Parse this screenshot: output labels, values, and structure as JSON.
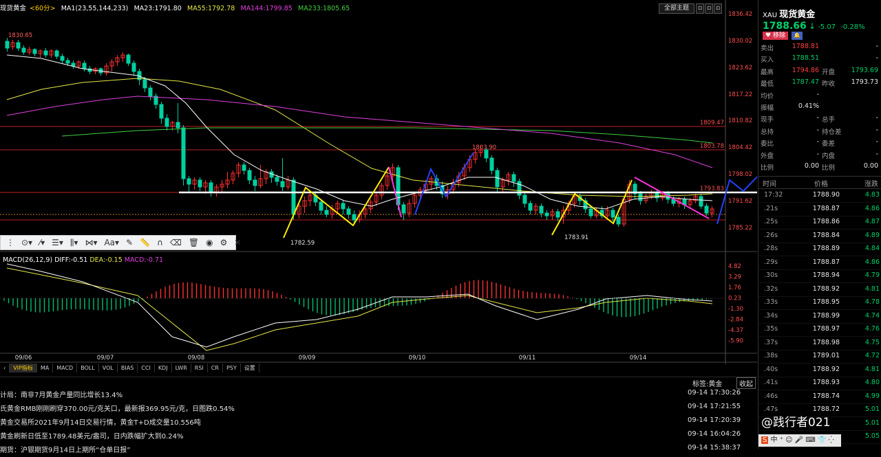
{
  "header": {
    "symbol_name": "现货黄金",
    "period": "<60分>",
    "ma_label": "MA1(23,55,144,233)",
    "ma23": "MA23:1791.80",
    "ma55": "MA55:1792.78",
    "ma144": "MA144:1799.85",
    "ma233": "MA233:1805.65",
    "theme_button": "全部主题",
    "colors": {
      "ma23": "#ffffff",
      "ma55": "#e8e84a",
      "ma144": "#e040e0",
      "ma233": "#40d040",
      "up": "#ff3030",
      "down": "#00d0a0"
    }
  },
  "price_axis": [
    "1836.42",
    "1830.02",
    "1823.62",
    "1817.22",
    "1810.82",
    "1804.42",
    "1798.02",
    "1791.62",
    "1785.22"
  ],
  "price_labels": {
    "high": "1830.65",
    "peak": "1803.90",
    "low1": "1782.59",
    "low2": "1783.91",
    "level1": "1809.47",
    "level2": "1803.78",
    "level3": "1793.83"
  },
  "macd": {
    "label": "MACD(26,12,9)",
    "diff": "DIFF:-0.51",
    "dea": "DEA:-0.15",
    "macd": "MACD:-0.71",
    "axis": [
      "4.82",
      "3.29",
      "1.76",
      "0.23",
      "-1.30",
      "-2.84",
      "-4.37",
      "-5.90"
    ]
  },
  "dates": [
    "09/06",
    "09/07",
    "09/08",
    "09/09",
    "09/10",
    "09/11",
    "09/14"
  ],
  "indicator_tabs": [
    "VIP指标",
    "MA",
    "MACD",
    "BOLL",
    "VOL",
    "BIAS",
    "CCI",
    "KDJ",
    "LWR",
    "RSI",
    "CR",
    "PSY",
    "设置"
  ],
  "news": {
    "tag": "标签:黄金",
    "collapse": "收起",
    "items": [
      {
        "text": "计局：南非7月黄金产量同比增长13.4%",
        "date": "09-14 17:30:26"
      },
      {
        "text": "氏黄金RMB刚刚刷穿370.00元/克关口，最新报369.95元/克，日图跌0.54%",
        "date": "09-14 17:21:55"
      },
      {
        "text": "黄金交易所2021年9月14日交易行情，黄金T+D成交量10.556吨",
        "date": "09-14 17:20:39"
      },
      {
        "text": "黄金刷新日低至1789.48美元/盎司，日内跌幅扩大到0.24%",
        "date": "09-14 16:04:26"
      },
      {
        "text": "期货：沪银期货9月14日上期所“仓单日报”",
        "date": "09-14 15:38:37"
      }
    ]
  },
  "quote": {
    "code": "XAU",
    "name": "现货黄金",
    "price": "1788.66",
    "arrow": "↓",
    "change": "-5.07",
    "pct": "-0.28%",
    "btn_remove": "移除",
    "btn_alert": "🔔",
    "fields": [
      {
        "l": "卖出",
        "v": "1788.81",
        "l2": "",
        "v2": "-"
      },
      {
        "l": "买入",
        "v": "1788.51",
        "l2": "",
        "v2": "-"
      },
      {
        "l": "最高",
        "v": "1794.86",
        "l2": "开盘",
        "v2": "1793.69"
      },
      {
        "l": "最低",
        "v": "1787.47",
        "l2": "昨收",
        "v2": "1793.73"
      },
      {
        "l": "均价",
        "v": "-",
        "l2": "",
        "v2": ""
      },
      {
        "l": "振幅",
        "v": "0.41%",
        "l2": "",
        "v2": ""
      },
      {
        "l": "现手",
        "v": "-",
        "l2": "总手",
        "v2": "-"
      },
      {
        "l": "总持",
        "v": "-",
        "l2": "持仓差",
        "v2": "-"
      },
      {
        "l": "委比",
        "v": "-",
        "l2": "委差",
        "v2": "-"
      },
      {
        "l": "外盘",
        "v": "-",
        "l2": "内盘",
        "v2": "-"
      },
      {
        "l": "比例",
        "v": "0.00",
        "l2": "比例",
        "v2": "0.00"
      }
    ],
    "tick_headers": [
      "时间",
      "价格",
      "涨跌"
    ],
    "ticks": [
      {
        "t": "17:32",
        "p": "1788.90",
        "c": "4.83"
      },
      {
        "t": ".21s",
        "p": "1788.87",
        "c": "4.86"
      },
      {
        "t": ".25s",
        "p": "1788.86",
        "c": "4.87"
      },
      {
        "t": ".26s",
        "p": "1788.84",
        "c": "4.89"
      },
      {
        "t": ".28s",
        "p": "1788.89",
        "c": "4.84"
      },
      {
        "t": ".29s",
        "p": "1788.87",
        "c": "4.86"
      },
      {
        "t": ".30s",
        "p": "1788.94",
        "c": "4.79"
      },
      {
        "t": ".32s",
        "p": "1788.92",
        "c": "4.81"
      },
      {
        "t": ".33s",
        "p": "1788.95",
        "c": "4.78"
      },
      {
        "t": ".34s",
        "p": "1788.99",
        "c": "4.74"
      },
      {
        "t": ".35s",
        "p": "1788.97",
        "c": "4.76"
      },
      {
        "t": ".37s",
        "p": "1788.98",
        "c": "4.75"
      },
      {
        "t": ".38s",
        "p": "1789.01",
        "c": "4.72"
      },
      {
        "t": ".40s",
        "p": "1788.92",
        "c": "4.81"
      },
      {
        "t": ".41s",
        "p": "1788.93",
        "c": "4.80"
      },
      {
        "t": ".46s",
        "p": "1788.74",
        "c": "4.99"
      },
      {
        "t": ".47s",
        "p": "1788.72",
        "c": "5.01"
      },
      {
        "t": "",
        "p": "",
        "c": "5.01"
      },
      {
        "t": "",
        "p": "",
        "c": "5.05"
      }
    ],
    "watermark": "@践行者021"
  }
}
